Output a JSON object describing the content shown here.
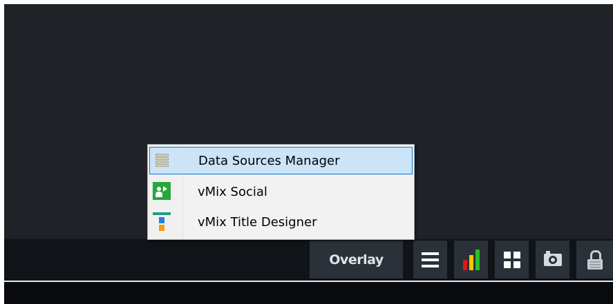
{
  "menu": {
    "items": [
      {
        "label": "Data Sources Manager",
        "icon": "database-icon",
        "highlighted": true
      },
      {
        "label": "vMix Social",
        "icon": "social-icon",
        "highlighted": false
      },
      {
        "label": "vMix Title Designer",
        "icon": "title-designer-icon",
        "highlighted": false
      }
    ]
  },
  "toolbar": {
    "overlay_label": "Overlay",
    "icons": [
      "list-icon",
      "audio-meter-icon",
      "multiview-icon",
      "snapshot-icon",
      "lock-icon"
    ]
  },
  "colors": {
    "background": "#1f2328",
    "toolbar": "#101418",
    "button": "#2b3138",
    "menu_highlight": "#cce4f7",
    "menu_highlight_border": "#0078d7"
  }
}
